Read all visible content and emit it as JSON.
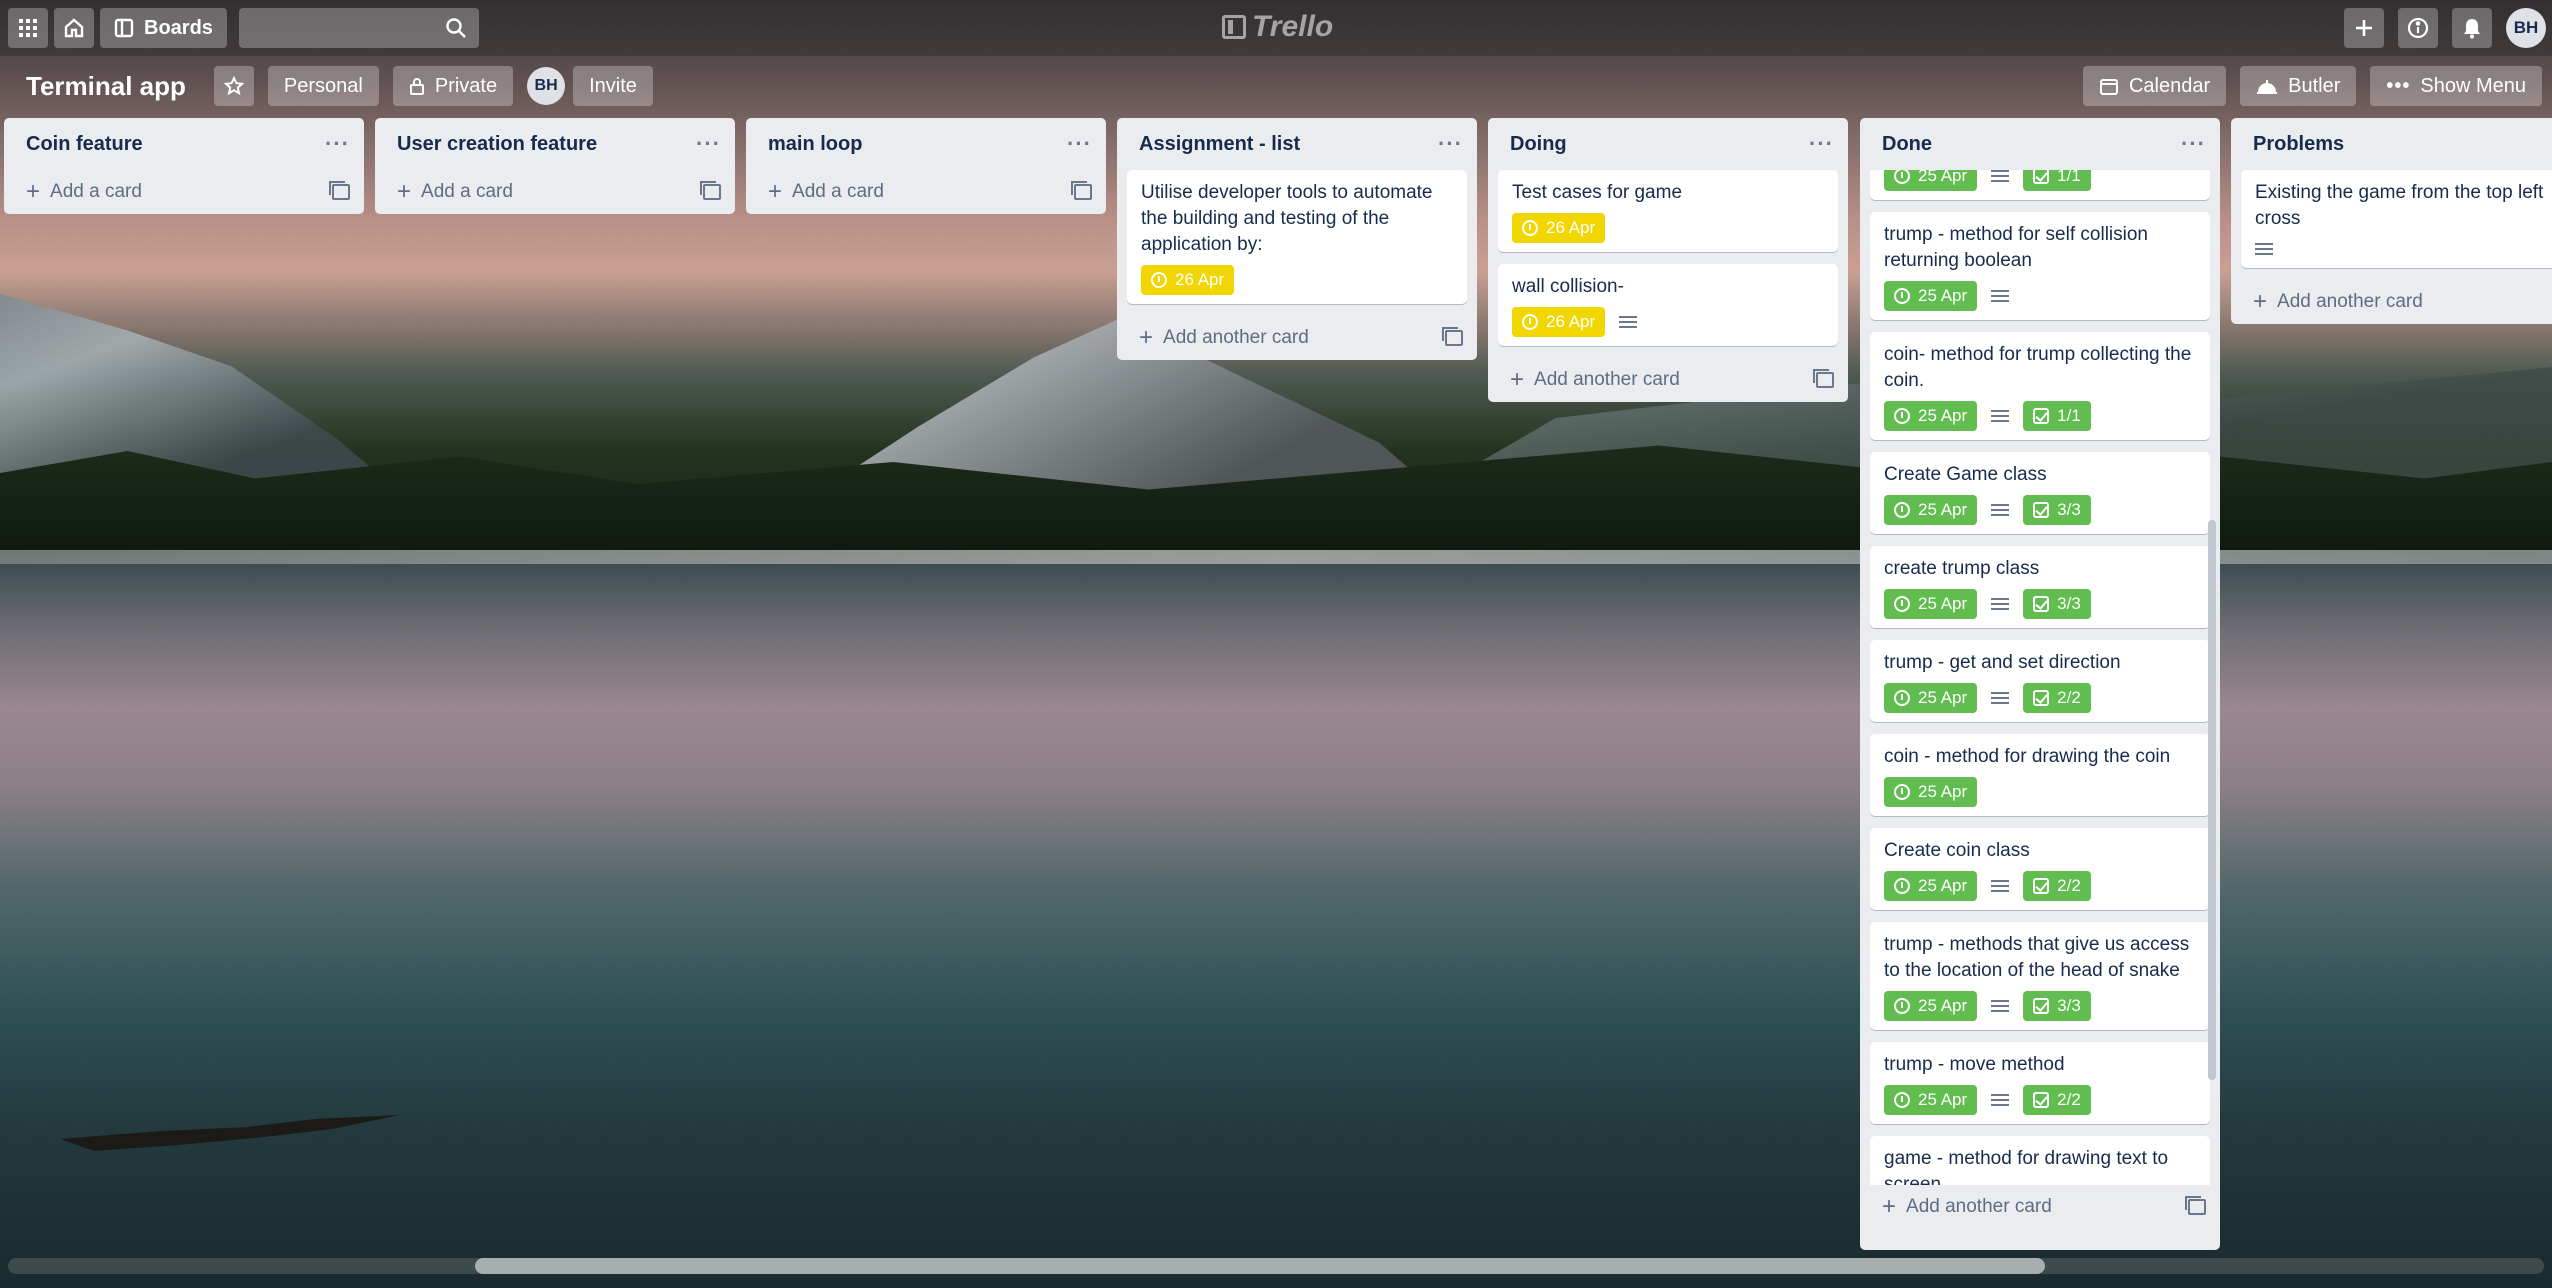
{
  "topbar": {
    "boards_label": "Boards",
    "search_placeholder": "",
    "logo_text": "Trello",
    "avatar_initials": "BH"
  },
  "board": {
    "title": "Terminal app",
    "visibility_team": "Personal",
    "visibility": "Private",
    "member_initials": "BH",
    "invite_label": "Invite",
    "calendar_label": "Calendar",
    "butler_label": "Butler",
    "show_menu_label": "Show Menu"
  },
  "lists": {
    "coin": {
      "title": "Coin feature",
      "footer": "Add a card"
    },
    "user": {
      "title": "User creation feature",
      "footer": "Add a card"
    },
    "main": {
      "title": "main loop",
      "footer": "Add a card"
    },
    "assignment": {
      "title": "Assignment - list",
      "footer": "Add another card",
      "cards": [
        {
          "text": "Utilise developer tools to automate the building and testing of the application by:",
          "due": "26 Apr"
        }
      ]
    },
    "doing": {
      "title": "Doing",
      "footer": "Add another card",
      "cards": [
        {
          "text": "Test cases for game",
          "due": "26 Apr"
        },
        {
          "text": "wall collision-",
          "due": "26 Apr"
        }
      ]
    },
    "done": {
      "title": "Done",
      "footer": "Add another card",
      "cards": [
        {
          "text": "",
          "due": "25 Apr",
          "checklist": "1/1"
        },
        {
          "text": "trump - method for self collision returning boolean",
          "due": "25 Apr"
        },
        {
          "text": "coin- method for trump collecting the coin.",
          "due": "25 Apr",
          "checklist": "1/1"
        },
        {
          "text": "Create Game class",
          "due": "25 Apr",
          "checklist": "3/3"
        },
        {
          "text": "create trump class",
          "due": "25 Apr",
          "checklist": "3/3"
        },
        {
          "text": "trump - get and set direction",
          "due": "25 Apr",
          "checklist": "2/2"
        },
        {
          "text": "coin - method for drawing the coin",
          "due": "25 Apr"
        },
        {
          "text": "Create coin class",
          "due": "25 Apr",
          "checklist": "2/2"
        },
        {
          "text": "trump - methods that give us access to the location of the head of snake",
          "due": "25 Apr",
          "checklist": "3/3"
        },
        {
          "text": "trump - move method",
          "due": "25 Apr",
          "checklist": "2/2"
        },
        {
          "text": "game - method for drawing text to screen."
        }
      ]
    },
    "problems": {
      "title": "Problems",
      "footer": "Add another card",
      "cards": [
        {
          "text": "Existing the game from the top left cross"
        }
      ]
    }
  },
  "colors": {
    "due_green": "#61bd4f",
    "due_yellow": "#f2d600",
    "list_bg": "#ebecf0"
  }
}
